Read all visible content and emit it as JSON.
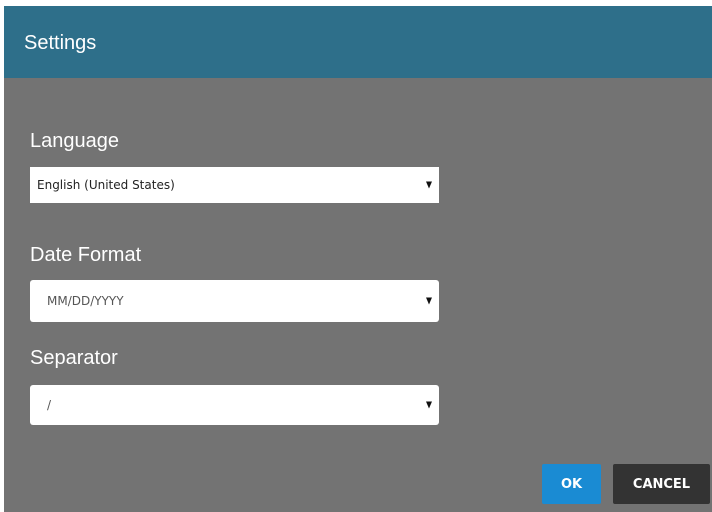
{
  "dialog": {
    "title": "Settings",
    "fields": [
      {
        "label": "Language",
        "value": "English (United States)"
      },
      {
        "label": "Date Format",
        "value": "MM/DD/YYYY"
      },
      {
        "label": "Separator",
        "value": "/"
      }
    ],
    "buttons": {
      "ok": "OK",
      "cancel": "CANCEL"
    }
  },
  "colors": {
    "titlebar": "#2e6f8a",
    "body": "#737373",
    "ok_button": "#1a8bd3",
    "cancel_button": "#333333"
  },
  "icons": [
    "dropdown-arrow-icon"
  ]
}
